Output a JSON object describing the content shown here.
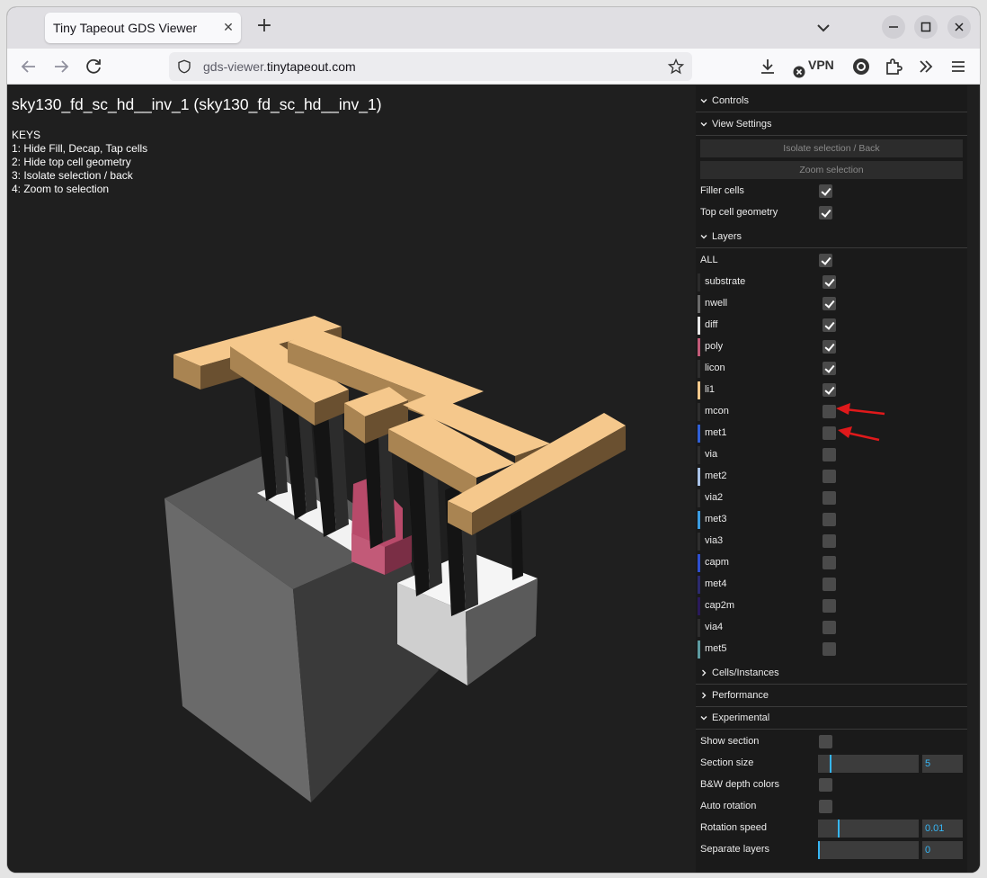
{
  "browser": {
    "tab_title": "Tiny Tapeout GDS Viewer",
    "url_host_dim": "gds-viewer.",
    "url_host": "tinytapeout.com",
    "vpn_label": "VPN"
  },
  "viewer": {
    "title": "sky130_fd_sc_hd__inv_1 (sky130_fd_sc_hd__inv_1)",
    "keys": [
      "KEYS",
      "1: Hide Fill, Decap, Tap cells",
      "2: Hide top cell geometry",
      "3: Isolate selection / back",
      "4: Zoom to selection"
    ]
  },
  "gui": {
    "controls": "Controls",
    "view_settings": {
      "label": "View Settings",
      "isolate_button": "Isolate selection / Back",
      "zoom_button": "Zoom selection",
      "filler_cells": "Filler cells",
      "top_cell_geometry": "Top cell geometry"
    },
    "layers": {
      "label": "Layers",
      "all": "ALL",
      "items": [
        {
          "name": "substrate",
          "color": "#2b2b2b",
          "checked": true
        },
        {
          "name": "nwell",
          "color": "#6b6b6b",
          "checked": true
        },
        {
          "name": "diff",
          "color": "#e8e8e8",
          "checked": true
        },
        {
          "name": "poly",
          "color": "#c25a78",
          "checked": true
        },
        {
          "name": "licon",
          "color": "#2e2e2e",
          "checked": true
        },
        {
          "name": "li1",
          "color": "#f5c88c",
          "checked": true
        },
        {
          "name": "mcon",
          "color": "#2e2e2e",
          "checked": false
        },
        {
          "name": "met1",
          "color": "#2f5fd6",
          "checked": false
        },
        {
          "name": "via",
          "color": "#2e2e2e",
          "checked": false
        },
        {
          "name": "met2",
          "color": "#a9c2e6",
          "checked": false
        },
        {
          "name": "via2",
          "color": "#2e2e2e",
          "checked": false
        },
        {
          "name": "met3",
          "color": "#3a9be0",
          "checked": false
        },
        {
          "name": "via3",
          "color": "#2e2e2e",
          "checked": false
        },
        {
          "name": "capm",
          "color": "#2e4fd0",
          "checked": false
        },
        {
          "name": "met4",
          "color": "#2c2a6e",
          "checked": false
        },
        {
          "name": "cap2m",
          "color": "#2a1a5a",
          "checked": false
        },
        {
          "name": "via4",
          "color": "#2e2e2e",
          "checked": false
        },
        {
          "name": "met5",
          "color": "#5c9aa0",
          "checked": false
        }
      ]
    },
    "cells_instances": "Cells/Instances",
    "performance": "Performance",
    "experimental": {
      "label": "Experimental",
      "show_section": "Show section",
      "section_size": "Section size",
      "section_size_value": "5",
      "section_size_fraction": 0.12,
      "bw_depth": "B&W depth colors",
      "auto_rotation": "Auto rotation",
      "rotation_speed": "Rotation speed",
      "rotation_speed_value": "0.01",
      "rotation_speed_fraction": 0.2,
      "separate_layers": "Separate layers",
      "separate_layers_value": "0",
      "separate_layers_fraction": 0.0
    }
  },
  "colors": {
    "accent": "#36b6f5",
    "li1": "#f5c88c",
    "poly": "#c25a78",
    "substrate": "#555555",
    "annotation_arrow": "#e0191b"
  }
}
